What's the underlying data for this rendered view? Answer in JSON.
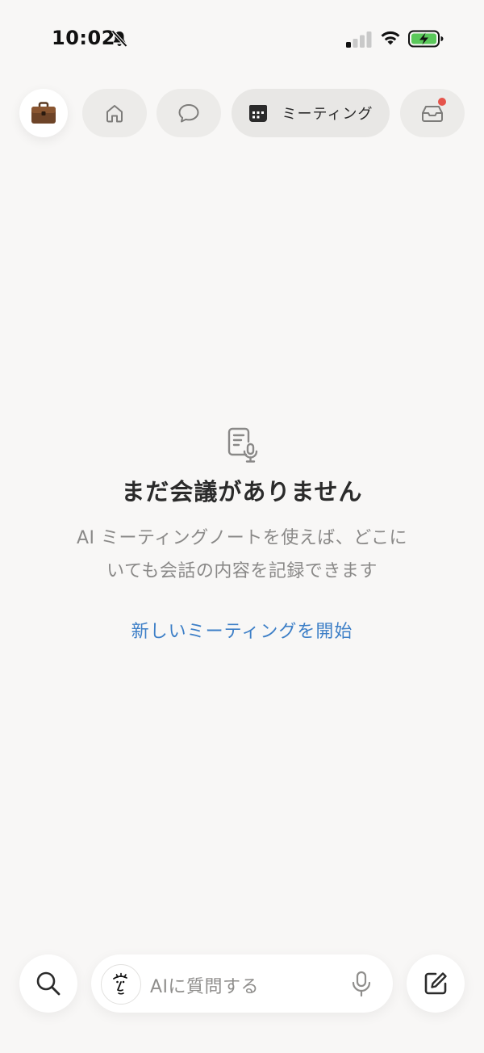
{
  "status_bar": {
    "time": "10:02"
  },
  "nav": {
    "workspace_icon": "briefcase-emoji",
    "tabs": [
      {
        "name": "home",
        "icon": "home-icon"
      },
      {
        "name": "chat",
        "icon": "chat-bubble-icon"
      },
      {
        "name": "meetings",
        "icon": "calendar-icon",
        "label": "ミーティング",
        "selected": true
      },
      {
        "name": "inbox",
        "icon": "inbox-icon",
        "has_notification": true
      }
    ]
  },
  "empty_state": {
    "icon": "document-mic-icon",
    "title": "まだ会議がありません",
    "description": "AI ミーティングノートを使えば、どこにいても会話の内容を記録できます",
    "action_label": "新しいミーティングを開始"
  },
  "bottom_bar": {
    "ask_placeholder": "AIに質問する",
    "icons": [
      "search-icon",
      "ai-face-icon",
      "mic-icon",
      "compose-icon"
    ]
  },
  "colors": {
    "background": "#f8f7f6",
    "link": "#3d7fc7",
    "notification": "#e5544b",
    "battery_fill": "#5ac85a"
  }
}
